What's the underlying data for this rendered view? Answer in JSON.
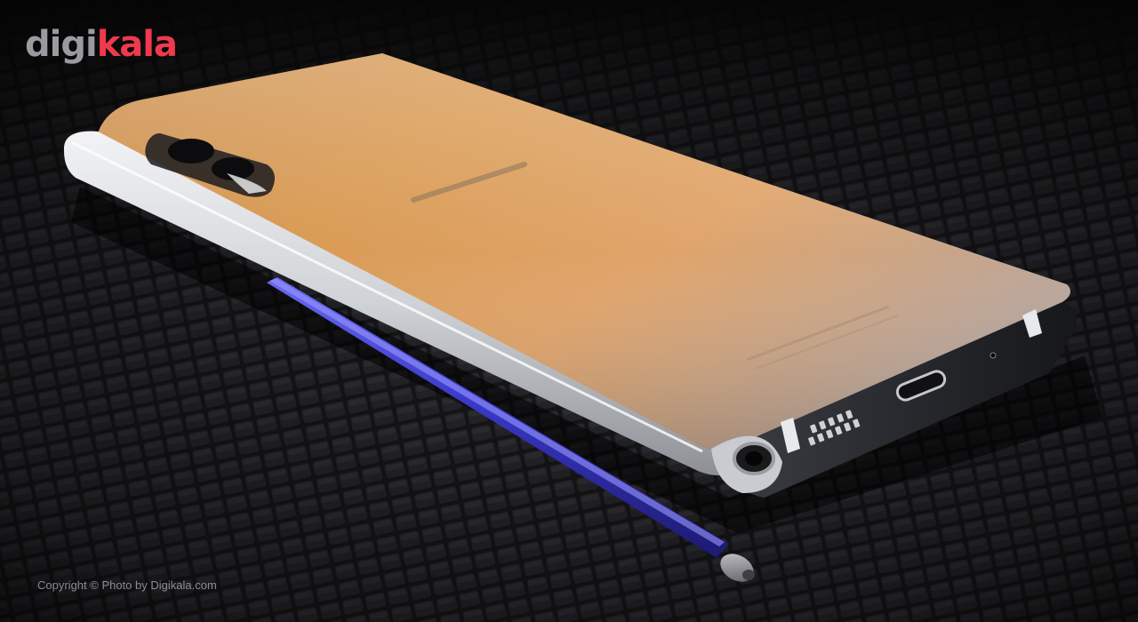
{
  "brand": {
    "logo_part1": "digi",
    "logo_part2": "kala",
    "logo_color_primary": "#9a9aa0",
    "logo_color_accent": "#ef394e"
  },
  "credit": {
    "text": "Copyright ©  Photo by Digikala.com"
  },
  "scene": {
    "subject": "smartphone-with-stylus",
    "colors": {
      "background": "#141416",
      "phone_back_warm": "#d98a3e",
      "phone_back_cool": "#b9b0a8",
      "frame_silver": "#d8dade",
      "stylus_blue": "#2f2fb8"
    }
  }
}
